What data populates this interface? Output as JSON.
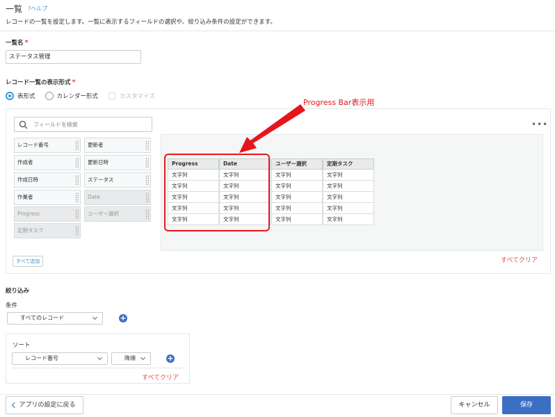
{
  "header": {
    "title": "一覧",
    "help": "?ヘルプ",
    "description": "レコードの一覧を設定します。一覧に表示するフィールドの選択や、絞り込み条件の設定ができます。"
  },
  "list_name": {
    "label": "一覧名",
    "required_mark": "*",
    "value": "ステータス管理"
  },
  "display_format": {
    "label": "レコード一覧の表示形式",
    "required_mark": "*",
    "options": [
      {
        "label": "表形式",
        "selected": true,
        "disabled": false
      },
      {
        "label": "カレンダー形式",
        "selected": false,
        "disabled": false
      },
      {
        "label": "カスタマイズ",
        "selected": false,
        "disabled": true
      }
    ]
  },
  "field_search": {
    "placeholder": "フィールドを検索"
  },
  "fields": [
    {
      "label": "レコード番号",
      "disabled": false
    },
    {
      "label": "更新者",
      "disabled": false
    },
    {
      "label": "作成者",
      "disabled": false
    },
    {
      "label": "更新日時",
      "disabled": false
    },
    {
      "label": "作成日時",
      "disabled": false
    },
    {
      "label": "ステータス",
      "disabled": false
    },
    {
      "label": "作業者",
      "disabled": false
    },
    {
      "label": "Date",
      "disabled": true
    },
    {
      "label": "Progress",
      "disabled": true
    },
    {
      "label": "ユーザー選択",
      "disabled": true
    },
    {
      "label": "定期タスク",
      "disabled": true
    }
  ],
  "add_all_label": "すべて追加",
  "more_icon": "•••",
  "table_columns": [
    {
      "header": "Progress",
      "cells": [
        "文字列",
        "文字列",
        "文字列",
        "文字列",
        "文字列"
      ]
    },
    {
      "header": "Date",
      "cells": [
        "文字列",
        "文字列",
        "文字列",
        "文字列",
        "文字列"
      ]
    },
    {
      "header": "ユーザー選択",
      "cells": [
        "文字列",
        "文字列",
        "文字列",
        "文字列",
        "文字列"
      ]
    },
    {
      "header": "定期タスク",
      "cells": [
        "文字列",
        "文字列",
        "文字列",
        "文字列",
        "文字列"
      ]
    }
  ],
  "annotation": "Progress Bar表示用",
  "clear_all_label": "すべてクリア",
  "filter": {
    "label": "絞り込み",
    "condition_label": "条件",
    "condition_value": "すべてのレコード",
    "sort_label": "ソート",
    "sort_field": "レコード番号",
    "sort_order": "降順",
    "clear_label": "すべてクリア"
  },
  "footer": {
    "back_label": "アプリの設定に戻る",
    "cancel_label": "キャンセル",
    "save_label": "保存"
  },
  "colors": {
    "accent": "#3b6fc4",
    "link": "#3498db",
    "danger": "#e74b3c",
    "annotation": "#e8141b"
  }
}
